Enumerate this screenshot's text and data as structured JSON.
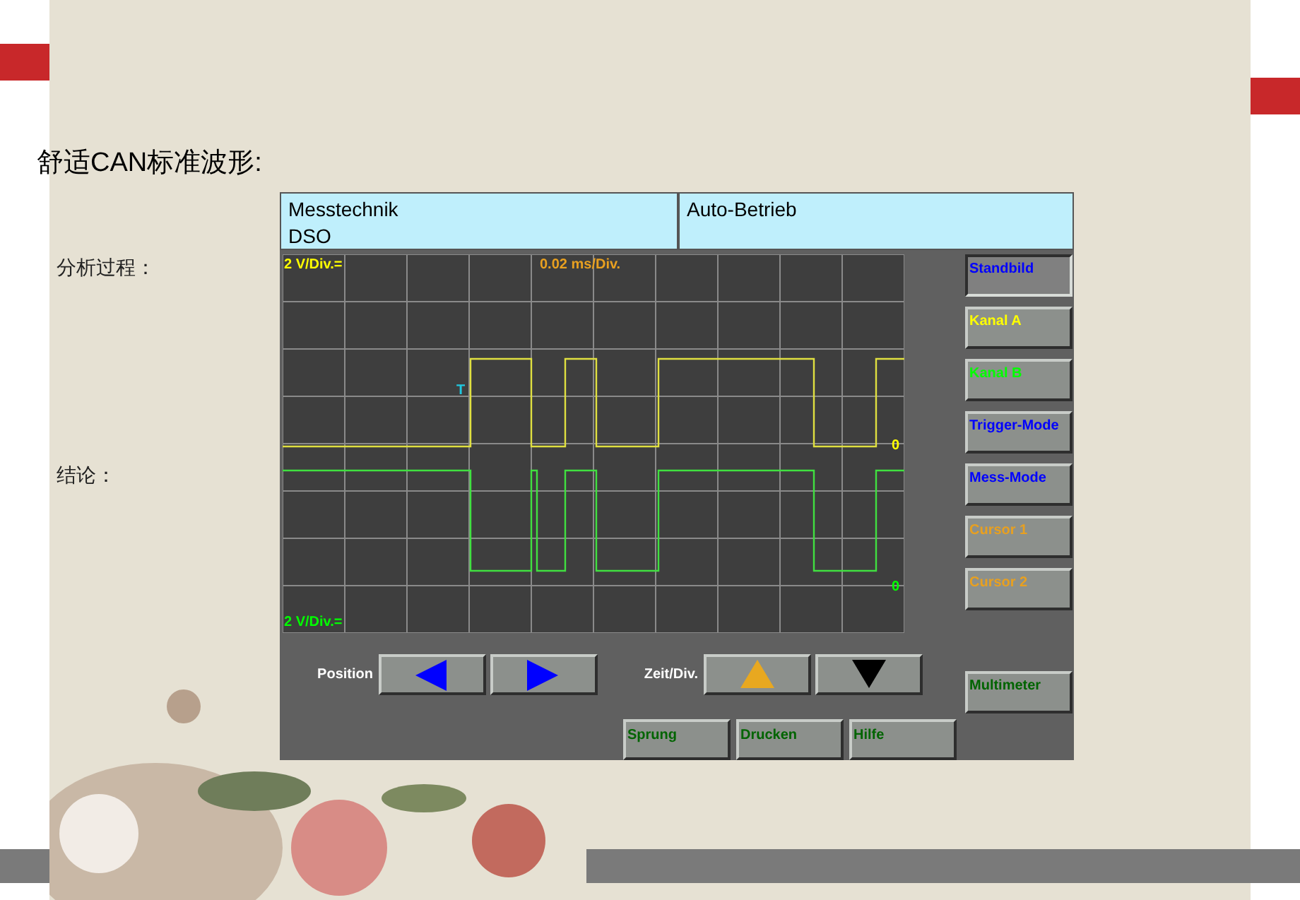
{
  "slide": {
    "title": "舒适CAN标准波形:",
    "labels": [
      "分析过程：",
      "结论："
    ]
  },
  "scope": {
    "header": [
      {
        "lines": [
          "Messtechnik",
          "DSO"
        ]
      },
      {
        "lines": [
          "Auto-Betrieb"
        ]
      }
    ],
    "display": {
      "channel_a_scale": "2 V/Div.=",
      "timebase": "0.02 ms/Div.",
      "channel_b_scale": "2 V/Div.=",
      "trigger_marker": "T",
      "channel_a_zero": "0",
      "channel_b_zero": "0"
    },
    "side_buttons": [
      {
        "label": "Standbild",
        "color": "#0000ff",
        "pressed": true
      },
      {
        "label": "Kanal A",
        "color": "#ffff00",
        "pressed": false
      },
      {
        "label": "Kanal B",
        "color": "#00ff00",
        "pressed": false
      },
      {
        "label": "Trigger-Mode",
        "color": "#0000ff",
        "pressed": false
      },
      {
        "label": "Mess-Mode",
        "color": "#0000ff",
        "pressed": false
      },
      {
        "label": "Cursor 1",
        "color": "#e8a020",
        "pressed": false
      },
      {
        "label": "Cursor 2",
        "color": "#e8a020",
        "pressed": false
      },
      {
        "label": "Multimeter",
        "color": "#006400",
        "pressed": false
      }
    ],
    "controls": [
      {
        "label": "Position",
        "buttons": [
          {
            "kind": "left",
            "color": "#0000ff"
          },
          {
            "kind": "right",
            "color": "#0000ff"
          }
        ]
      },
      {
        "label": "Zeit/Div.",
        "buttons": [
          {
            "kind": "up",
            "color": "#e8a820"
          },
          {
            "kind": "down",
            "color": "#000000"
          }
        ]
      }
    ],
    "bottom_buttons": [
      {
        "label": "Sprung"
      },
      {
        "label": "Drucken"
      },
      {
        "label": "Hilfe"
      }
    ]
  }
}
